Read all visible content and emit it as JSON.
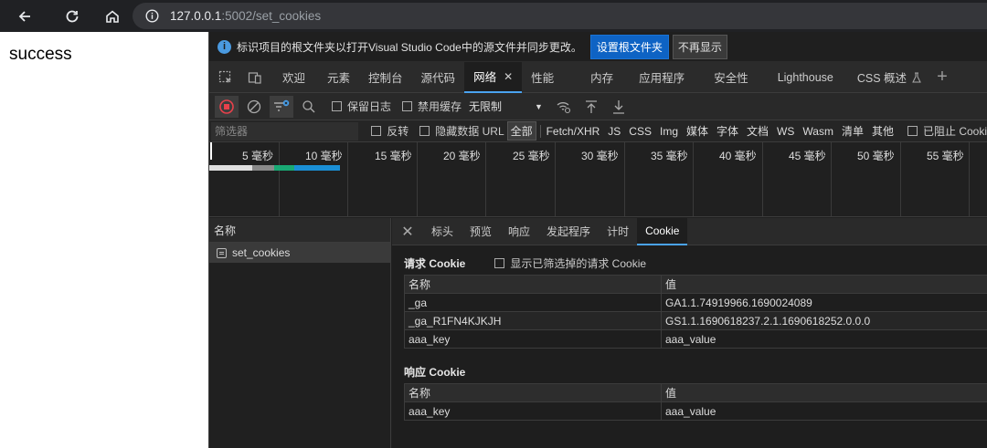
{
  "browser": {
    "url_host": "127.0.0.1",
    "url_rest": ":5002/set_cookies"
  },
  "page": {
    "body_text": "success"
  },
  "infobar": {
    "message": "标识项目的根文件夹以打开Visual Studio Code中的源文件并同步更改。",
    "primary_button": "设置根文件夹",
    "secondary_button": "不再显示"
  },
  "tabs": [
    {
      "label": "欢迎"
    },
    {
      "label": "元素"
    },
    {
      "label": "控制台"
    },
    {
      "label": "源代码"
    },
    {
      "label": "网络",
      "active": true,
      "closable": true
    },
    {
      "label": "性能"
    },
    {
      "label": "内存"
    },
    {
      "label": "应用程序"
    },
    {
      "label": "安全性"
    },
    {
      "label": "Lighthouse"
    },
    {
      "label": "CSS 概述"
    }
  ],
  "toolbar": {
    "preserve_log": "保留日志",
    "disable_cache": "禁用缓存",
    "throttling": "无限制"
  },
  "filter": {
    "placeholder": "筛选器",
    "invert": "反转",
    "hide_data_urls": "隐藏数据 URL",
    "types": [
      "全部",
      "Fetch/XHR",
      "JS",
      "CSS",
      "Img",
      "媒体",
      "字体",
      "文档",
      "WS",
      "Wasm",
      "清单",
      "其他"
    ],
    "blocked": "已阻止 Cooki"
  },
  "timeline": {
    "labels": [
      "5 毫秒",
      "10 毫秒",
      "15 毫秒",
      "20 毫秒",
      "25 毫秒",
      "30 毫秒",
      "35 毫秒",
      "40 毫秒",
      "45 毫秒",
      "50 毫秒",
      "55 毫秒"
    ]
  },
  "requests": {
    "header": "名称",
    "items": [
      {
        "name": "set_cookies"
      }
    ]
  },
  "detail": {
    "tabs": [
      "标头",
      "预览",
      "响应",
      "发起程序",
      "计时",
      "Cookie"
    ],
    "active_tab": "Cookie",
    "request_cookies_title": "请求 Cookie",
    "show_filtered": "显示已筛选掉的请求 Cookie",
    "col_name": "名称",
    "col_value": "值",
    "request_cookies": [
      {
        "name": "_ga",
        "value": "GA1.1.74919966.1690024089"
      },
      {
        "name": "_ga_R1FN4KJKJH",
        "value": "GS1.1.1690618237.2.1.1690618252.0.0.0"
      },
      {
        "name": "aaa_key",
        "value": "aaa_value"
      }
    ],
    "response_cookies_title": "响应 Cookie",
    "response_cookies": [
      {
        "name": "aaa_key",
        "value": "aaa_value"
      }
    ]
  },
  "colors": {
    "accent": "#4aa3f0",
    "primary_button": "#0e63c4",
    "record_red": "#e8414b"
  }
}
